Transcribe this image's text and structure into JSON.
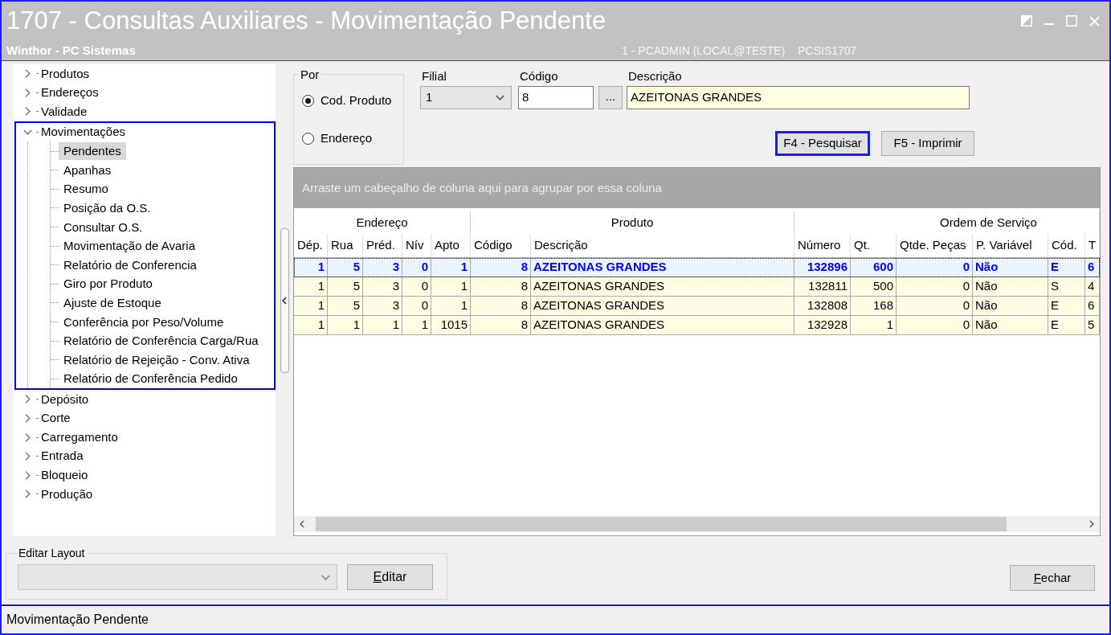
{
  "window": {
    "title": "1707 - Consultas Auxiliares - Movimentação Pendente",
    "subtitle": "Winthor - PC Sistemas",
    "session": "1 - PCADMIN (LOCAL@TESTE)",
    "routine": "PCSIS1707"
  },
  "sidebar": {
    "items": [
      {
        "label": "Produtos",
        "expanded": false,
        "highlighted": false
      },
      {
        "label": "Endereços",
        "expanded": false,
        "highlighted": false
      },
      {
        "label": "Validade",
        "expanded": false,
        "highlighted": false
      },
      {
        "label": "Movimentações",
        "expanded": true,
        "highlighted": true,
        "children": [
          {
            "label": "Pendentes",
            "selected": true
          },
          {
            "label": "Apanhas",
            "selected": false
          },
          {
            "label": "Resumo",
            "selected": false
          },
          {
            "label": "Posição da O.S.",
            "selected": false
          },
          {
            "label": "Consultar O.S.",
            "selected": false
          },
          {
            "label": "Movimentação de Avaria",
            "selected": false
          },
          {
            "label": "Relatório de Conferencia",
            "selected": false
          },
          {
            "label": "Giro por Produto",
            "selected": false
          },
          {
            "label": "Ajuste de Estoque",
            "selected": false
          },
          {
            "label": "Conferência por Peso/Volume",
            "selected": false
          },
          {
            "label": "Relatório de Conferência Carga/Rua",
            "selected": false
          },
          {
            "label": "Relatório de Rejeição - Conv. Ativa",
            "selected": false
          },
          {
            "label": "Relatório de Conferência Pedido",
            "selected": false
          }
        ]
      },
      {
        "label": "Depósito",
        "expanded": false,
        "highlighted": false
      },
      {
        "label": "Corte",
        "expanded": false,
        "highlighted": false
      },
      {
        "label": "Carregamento",
        "expanded": false,
        "highlighted": false
      },
      {
        "label": "Entrada",
        "expanded": false,
        "highlighted": false
      },
      {
        "label": "Bloqueio",
        "expanded": false,
        "highlighted": false
      },
      {
        "label": "Produção",
        "expanded": false,
        "highlighted": false
      }
    ]
  },
  "search": {
    "group": {
      "label": "Por",
      "options": [
        {
          "label": "Cod. Produto",
          "selected": true
        },
        {
          "label": "Endereço",
          "selected": false
        }
      ]
    },
    "branch": {
      "label": "Filial",
      "value": "1"
    },
    "code": {
      "label": "Código",
      "value": "8"
    },
    "lookup_button": "...",
    "description": {
      "label": "Descrição",
      "value": "AZEITONAS GRANDES"
    },
    "buttons": [
      {
        "label": "F4 - Pesquisar",
        "focused": true
      },
      {
        "label": "F5 - Imprimir",
        "focused": false
      }
    ]
  },
  "grid": {
    "group_panel_hint": "Arraste um cabeçalho de coluna aqui para agrupar por essa coluna",
    "column_groups": [
      {
        "label": "Endereço",
        "columns": [
          {
            "label": "Dép.",
            "kind": "number"
          },
          {
            "label": "Rua",
            "kind": "number"
          },
          {
            "label": "Préd.",
            "kind": "number"
          },
          {
            "label": "Nív",
            "kind": "number"
          },
          {
            "label": "Apto",
            "kind": "number"
          }
        ]
      },
      {
        "label": "Produto",
        "columns": [
          {
            "label": "Código",
            "kind": "number"
          },
          {
            "label": "Descrição",
            "kind": "text"
          }
        ]
      },
      {
        "label": "Ordem de Serviço",
        "columns": [
          {
            "label": "Número",
            "kind": "number"
          },
          {
            "label": "Qt.",
            "kind": "number"
          },
          {
            "label": "Qtde. Peças",
            "kind": "number"
          },
          {
            "label": "P. Variável",
            "kind": "text"
          },
          {
            "label": "Cód.",
            "kind": "text"
          },
          {
            "label": "T",
            "kind": "text"
          }
        ]
      }
    ],
    "rows": [
      {
        "selected": true,
        "cells": [
          "1",
          "5",
          "3",
          "0",
          "1",
          "8",
          "AZEITONAS GRANDES",
          "132896",
          "600",
          "0",
          "Não",
          "E",
          "6"
        ]
      },
      {
        "selected": false,
        "cells": [
          "1",
          "5",
          "3",
          "0",
          "1",
          "8",
          "AZEITONAS GRANDES",
          "132811",
          "500",
          "0",
          "Não",
          "S",
          "4"
        ]
      },
      {
        "selected": false,
        "cells": [
          "1",
          "5",
          "3",
          "0",
          "1",
          "8",
          "AZEITONAS GRANDES",
          "132808",
          "168",
          "0",
          "Não",
          "E",
          "6"
        ]
      },
      {
        "selected": false,
        "cells": [
          "1",
          "1",
          "1",
          "1",
          "1015",
          "8",
          "AZEITONAS GRANDES",
          "132928",
          "1",
          "0",
          "Não",
          "E",
          "5"
        ]
      }
    ]
  },
  "layout_editor": {
    "label": "Editar Layout",
    "selector": {
      "disabled": true
    },
    "button": "Editar"
  },
  "close_button": "Fechar",
  "status_bar": "Movimentação Pendente"
}
